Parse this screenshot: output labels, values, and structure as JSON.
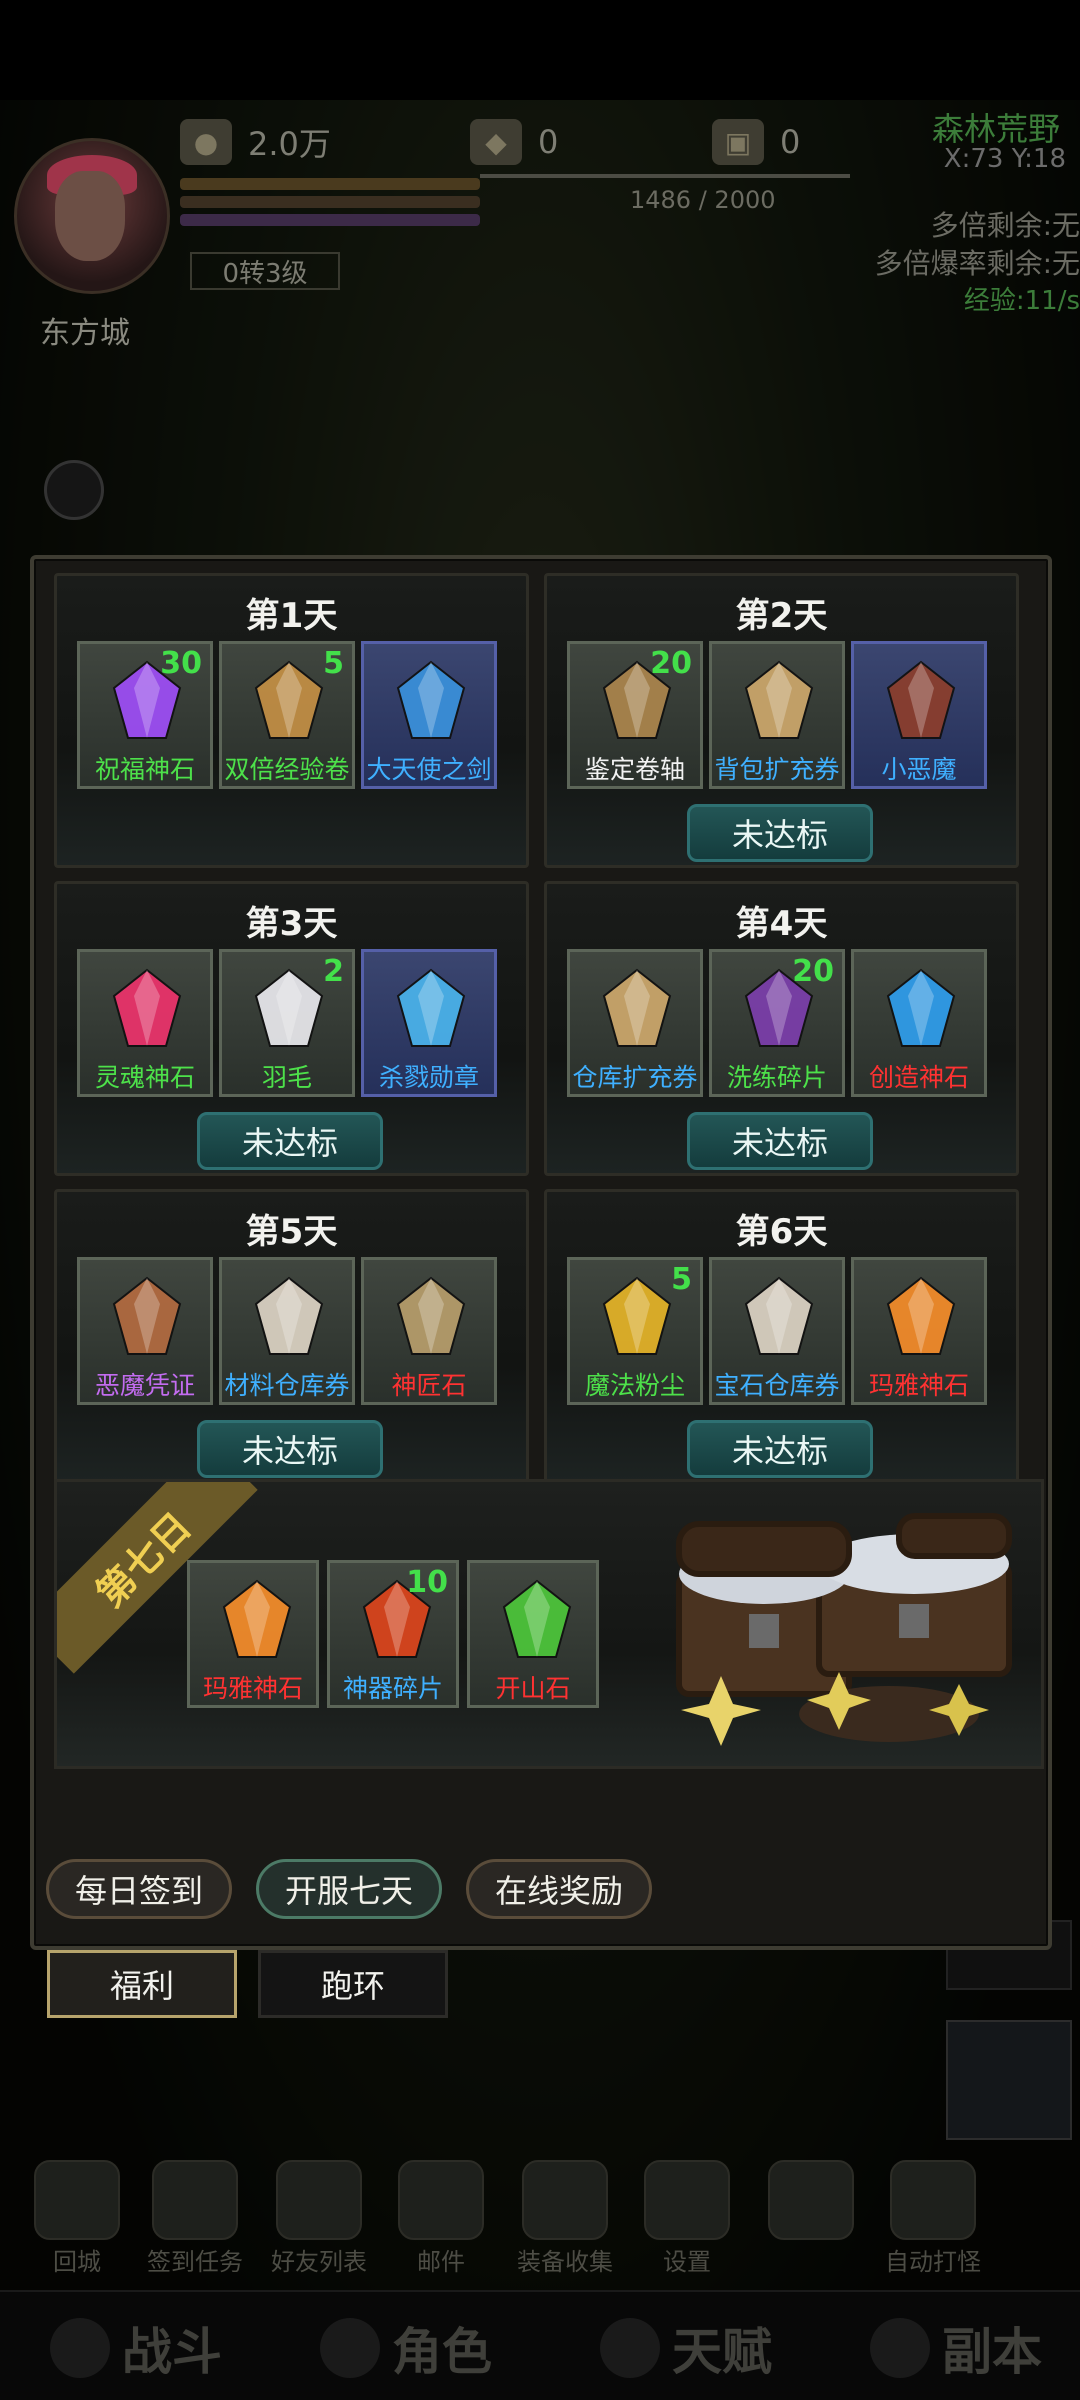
{
  "hud": {
    "city": "东方城",
    "gold": "2.0万",
    "ingot": "0",
    "box": "0",
    "level": "0转3级",
    "exp_text": "1486 / 2000",
    "map_name": "森林荒野",
    "coords": "X:73 Y:18",
    "multi_remaining": "多倍剩余:无",
    "multi_drop_remaining": "多倍爆率剩余:无",
    "exp_rate": "经验:11/s"
  },
  "days": [
    {
      "title": "第1天",
      "button": "",
      "items": [
        {
          "name": "祝福神石",
          "count": "30",
          "quality": "q-green",
          "icon": "purple-crystal-icon",
          "color": "#9c4df2",
          "epic": false
        },
        {
          "name": "双倍经验卷",
          "count": "5",
          "quality": "q-green",
          "icon": "scroll-icon",
          "color": "#c08d44",
          "epic": false
        },
        {
          "name": "大天使之剑",
          "count": "",
          "quality": "q-blue",
          "icon": "sword-icon",
          "color": "#3a8fd8",
          "epic": true
        }
      ]
    },
    {
      "title": "第2天",
      "button": "未达标",
      "items": [
        {
          "name": "鉴定卷轴",
          "count": "20",
          "quality": "q-white",
          "icon": "scroll-icon",
          "color": "#a8834c",
          "epic": false
        },
        {
          "name": "背包扩充券",
          "count": "",
          "quality": "q-blue",
          "icon": "ticket-icon",
          "color": "#c9a56a",
          "epic": false
        },
        {
          "name": "小恶魔",
          "count": "",
          "quality": "q-blue",
          "icon": "bat-wing-icon",
          "color": "#8a3e2e",
          "epic": true
        }
      ]
    },
    {
      "title": "第3天",
      "button": "未达标",
      "items": [
        {
          "name": "灵魂神石",
          "count": "",
          "quality": "q-green",
          "icon": "pink-gem-icon",
          "color": "#e8336a",
          "epic": false
        },
        {
          "name": "羽毛",
          "count": "2",
          "quality": "q-green",
          "icon": "feather-icon",
          "color": "#e4e4e8",
          "epic": false
        },
        {
          "name": "杀戮勋章",
          "count": "",
          "quality": "q-blue",
          "icon": "medal-icon",
          "color": "#4ab0e8",
          "epic": true
        }
      ]
    },
    {
      "title": "第4天",
      "button": "未达标",
      "items": [
        {
          "name": "仓库扩充券",
          "count": "",
          "quality": "q-blue",
          "icon": "ticket-icon",
          "color": "#c9a56a",
          "epic": false
        },
        {
          "name": "洗练碎片",
          "count": "20",
          "quality": "q-green",
          "icon": "shard-icon",
          "color": "#7a3ea8",
          "epic": false
        },
        {
          "name": "创造神石",
          "count": "",
          "quality": "q-red",
          "icon": "blue-gem-icon",
          "color": "#2f9be8",
          "epic": false
        }
      ]
    },
    {
      "title": "第5天",
      "button": "未达标",
      "items": [
        {
          "name": "恶魔凭证",
          "count": "",
          "quality": "q-purple",
          "icon": "demon-token-icon",
          "color": "#b06a40",
          "epic": false
        },
        {
          "name": "材料仓库券",
          "count": "",
          "quality": "q-blue",
          "icon": "ticket-icon",
          "color": "#d8cfc0",
          "epic": false
        },
        {
          "name": "神匠石",
          "count": "",
          "quality": "q-red",
          "icon": "orb-icon",
          "color": "#b49b6a",
          "epic": false
        }
      ]
    },
    {
      "title": "第6天",
      "button": "未达标",
      "items": [
        {
          "name": "魔法粉尘",
          "count": "5",
          "quality": "q-green",
          "icon": "powder-bag-icon",
          "color": "#e0b028",
          "epic": false
        },
        {
          "name": "宝石仓库券",
          "count": "",
          "quality": "q-blue",
          "icon": "ticket-icon",
          "color": "#d8cfc0",
          "epic": false
        },
        {
          "name": "玛雅神石",
          "count": "",
          "quality": "q-red",
          "icon": "orange-gem-icon",
          "color": "#f08a2a",
          "epic": false
        }
      ]
    }
  ],
  "day7": {
    "ribbon": "第七日",
    "items": [
      {
        "name": "玛雅神石",
        "count": "",
        "quality": "q-red",
        "icon": "orange-gem-icon",
        "color": "#f08a2a"
      },
      {
        "name": "神器碎片",
        "count": "10",
        "quality": "q-blue",
        "icon": "fire-orb-icon",
        "color": "#d8441c"
      },
      {
        "name": "开山石",
        "count": "",
        "quality": "q-red",
        "icon": "green-crystal-icon",
        "color": "#4cc23a"
      }
    ]
  },
  "pills": [
    "每日签到",
    "开服七天",
    "在线奖励"
  ],
  "sub_tabs": [
    "福利",
    "跑环"
  ],
  "bottom_menu": [
    "回城",
    "签到任务",
    "好友列表",
    "邮件",
    "装备收集",
    "设置",
    "",
    "自动打怪"
  ],
  "bottom_tabs": [
    "战斗",
    "角色",
    "天赋",
    "副本"
  ]
}
